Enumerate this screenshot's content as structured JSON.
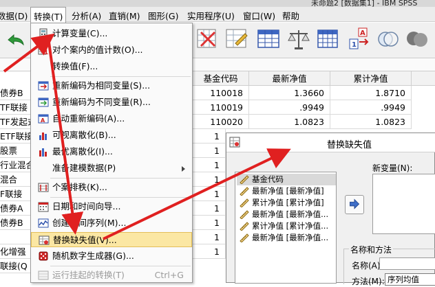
{
  "window": {
    "title": "未命题2 [数据集1] - IBM SPSS"
  },
  "menubar": {
    "items": [
      {
        "label": "数据(D)"
      },
      {
        "label": "转换(T)"
      },
      {
        "label": "分析(A)"
      },
      {
        "label": "直销(M)"
      },
      {
        "label": "图形(G)"
      },
      {
        "label": "实用程序(U)"
      },
      {
        "label": "窗口(W)"
      },
      {
        "label": "帮助"
      }
    ]
  },
  "grid": {
    "headers": [
      "基金代码",
      "最新净值",
      "累计净值"
    ],
    "left_cells": [
      "债券B",
      "TF联接",
      "TF发起式",
      "ETF联接",
      "股票",
      "行业混合",
      "混合",
      "F联接",
      "债券A",
      "债券B",
      "",
      "化增强",
      "联接(Q"
    ],
    "rows": [
      [
        "110018",
        "1.3660",
        "1.8710"
      ],
      [
        "110019",
        ".9949",
        ".9949"
      ],
      [
        "110020",
        "1.0823",
        "1.0823"
      ]
    ],
    "partial_first_col": [
      "1",
      "1",
      "1",
      "1",
      "1",
      "1",
      "1",
      "1",
      "1"
    ]
  },
  "menu": {
    "items": [
      {
        "label": "计算变量(C)...",
        "icon": "calculator-icon"
      },
      {
        "label": "对个案内的值计数(O)...",
        "icon": "count-icon"
      },
      {
        "label": "转换值(F)...",
        "icon": ""
      },
      {
        "label": "重新编码为相同变量(S)...",
        "icon": "recode-same-icon"
      },
      {
        "label": "重新编码为不同变量(R)...",
        "icon": "recode-different-icon"
      },
      {
        "label": "自动重新编码(A)...",
        "icon": "auto-recode-icon"
      },
      {
        "label": "可视离散化(B)...",
        "icon": "visual-binning-icon"
      },
      {
        "label": "最优离散化(I)...",
        "icon": "optimal-binning-icon"
      },
      {
        "label": "准备建模数据(P)",
        "icon": ""
      },
      {
        "label": "个案排秩(K)...",
        "icon": "rank-icon"
      },
      {
        "label": "日期和时间向导...",
        "icon": "calendar-icon"
      },
      {
        "label": "创建时间序列(M)...",
        "icon": "time-series-icon"
      },
      {
        "label": "替换缺失值(V)...",
        "icon": "replace-missing-icon"
      },
      {
        "label": "随机数字生成器(G)...",
        "icon": "dice-icon"
      },
      {
        "label": "运行挂起的转换(T)",
        "shortcut": "Ctrl+G",
        "icon": "run-pending-icon"
      }
    ]
  },
  "dialog": {
    "title": "替换缺失值",
    "variables": [
      "基金代码",
      "最新净值 [最新净值]",
      "累计净值 [累计净值]",
      "最新净值 [最新净值...",
      "累计净值 [累计净值...",
      "最新净值 [最新净值..."
    ],
    "new_var_label": "新变量(N):",
    "group_title": "名称和方法",
    "name_label": "名称(A):",
    "method_label": "方法(M):",
    "method_value": "序列均值"
  },
  "colors": {
    "highlight": "#fbe7a3",
    "arrow": "#e02020"
  }
}
